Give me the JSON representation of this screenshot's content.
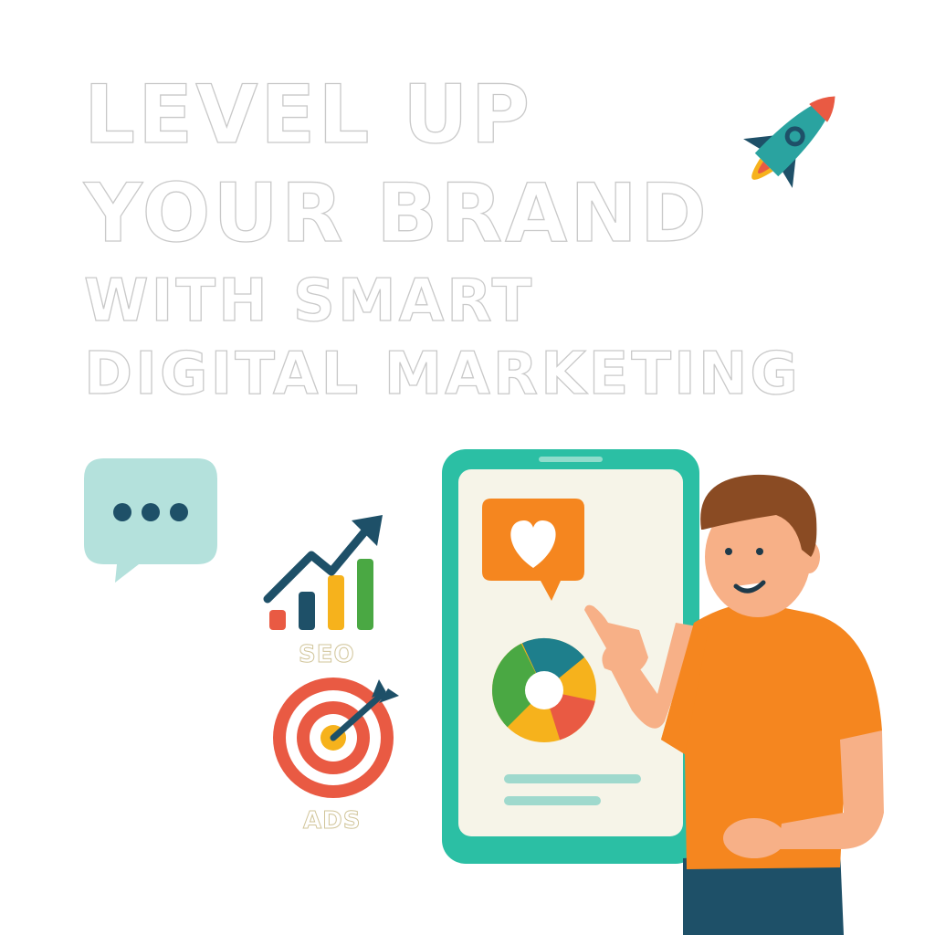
{
  "headline": {
    "line1": "LEVEL UP",
    "line2": "YOUR BRAND",
    "line3": "WITH SMART",
    "line4": "DIGITAL MARKETING"
  },
  "icons": {
    "rocket": "rocket-icon",
    "chat": "chat-bubble-icon",
    "seo_chart": "growth-chart-icon",
    "target": "target-icon",
    "phone": "smartphone-icon",
    "like": "heart-notification-icon",
    "donut": "donut-chart-icon",
    "person": "presenter-person-icon"
  },
  "labels": {
    "seo": "SEO",
    "ads": "ADS"
  },
  "colors": {
    "teal": "#2bbfa4",
    "dark_blue": "#1e5068",
    "orange": "#f5861f",
    "red": "#e95a43",
    "green": "#4aa843",
    "yellow": "#f6b21c"
  }
}
